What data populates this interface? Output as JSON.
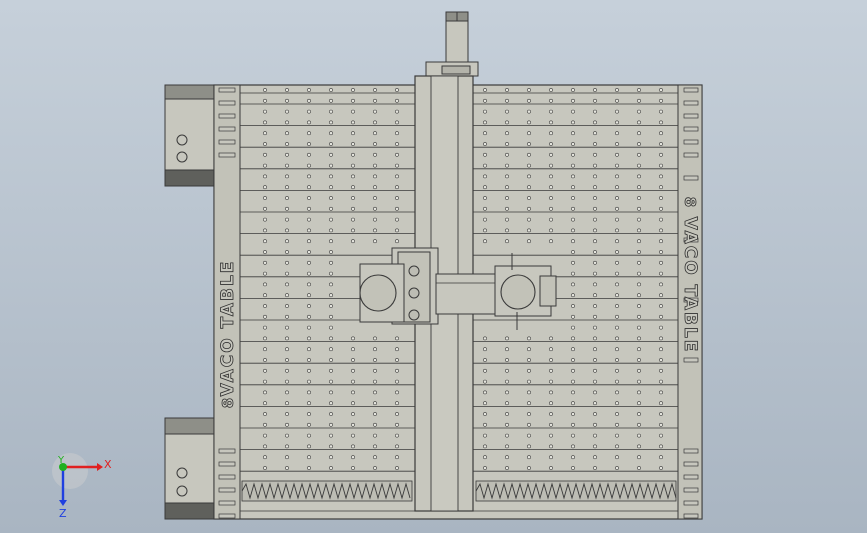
{
  "window": {
    "background_top": "#c6d0da",
    "background_bottom": "#a9b5c2"
  },
  "model": {
    "side_label": "VACO TABLE",
    "colors": {
      "body": "#c7c7be",
      "line": "#3a3a3a",
      "dark_block": "#5f605c",
      "hole": "#e6e6df"
    }
  },
  "triad": {
    "x_label": "X",
    "y_label": "Y",
    "z_label": "Z",
    "x_color": "#e02020",
    "y_color": "#20b020",
    "z_color": "#2040e0"
  }
}
